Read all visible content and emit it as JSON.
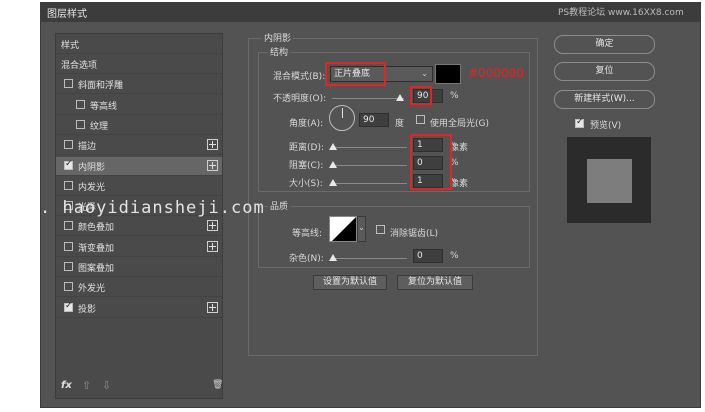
{
  "window": {
    "title": "图层样式",
    "watermark_top": "PS教程论坛 www.16XX8.com",
    "watermark_mid": ". haoyidiansheji.com"
  },
  "sidebar": {
    "header": "样式",
    "items": [
      {
        "label": "混合选项",
        "checkbox": null,
        "plus": false
      },
      {
        "label": "斜面和浮雕",
        "checkbox": false,
        "plus": false
      },
      {
        "label": "等高线",
        "checkbox": false,
        "plus": false
      },
      {
        "label": "纹理",
        "checkbox": false,
        "plus": false
      },
      {
        "label": "描边",
        "checkbox": false,
        "plus": true
      },
      {
        "label": "内阴影",
        "checkbox": true,
        "plus": true,
        "selected": true
      },
      {
        "label": "内发光",
        "checkbox": false,
        "plus": false
      },
      {
        "label": "光泽",
        "checkbox": false,
        "plus": false
      },
      {
        "label": "颜色叠加",
        "checkbox": false,
        "plus": true
      },
      {
        "label": "渐变叠加",
        "checkbox": false,
        "plus": true
      },
      {
        "label": "图案叠加",
        "checkbox": false,
        "plus": false
      },
      {
        "label": "外发光",
        "checkbox": false,
        "plus": false
      },
      {
        "label": "投影",
        "checkbox": true,
        "plus": true
      }
    ],
    "footer": {
      "fx": "fx",
      "up": "⇧",
      "down": "⇩",
      "trash": "🗑"
    }
  },
  "inner_shadow": {
    "section_title": "内阴影",
    "structure_title": "结构",
    "blend_mode_label": "混合模式(B):",
    "blend_mode_value": "正片叠底",
    "color_annotation": "#000000",
    "opacity_label": "不透明度(O):",
    "opacity_value": "90",
    "opacity_unit": "%",
    "angle_label": "角度(A):",
    "angle_value": "90",
    "angle_unit": "度",
    "global_light_label": "使用全局光(G)",
    "distance_label": "距离(D):",
    "distance_value": "1",
    "distance_unit": "像素",
    "choke_label": "阻塞(C):",
    "choke_value": "0",
    "choke_unit": "%",
    "size_label": "大小(S):",
    "size_value": "1",
    "size_unit": "像素",
    "quality_title": "品质",
    "contour_label": "等高线:",
    "antialias_label": "消除锯齿(L)",
    "noise_label": "杂色(N):",
    "noise_value": "0",
    "noise_unit": "%",
    "set_default_label": "设置为默认值",
    "reset_default_label": "复位为默认值"
  },
  "actions": {
    "ok_label": "确定",
    "reset_label": "复位",
    "new_style_label": "新建样式(W)...",
    "preview_label": "预览(V)"
  },
  "colors": {
    "shadow_color": "#000000",
    "annotation_red": "#e02525"
  }
}
